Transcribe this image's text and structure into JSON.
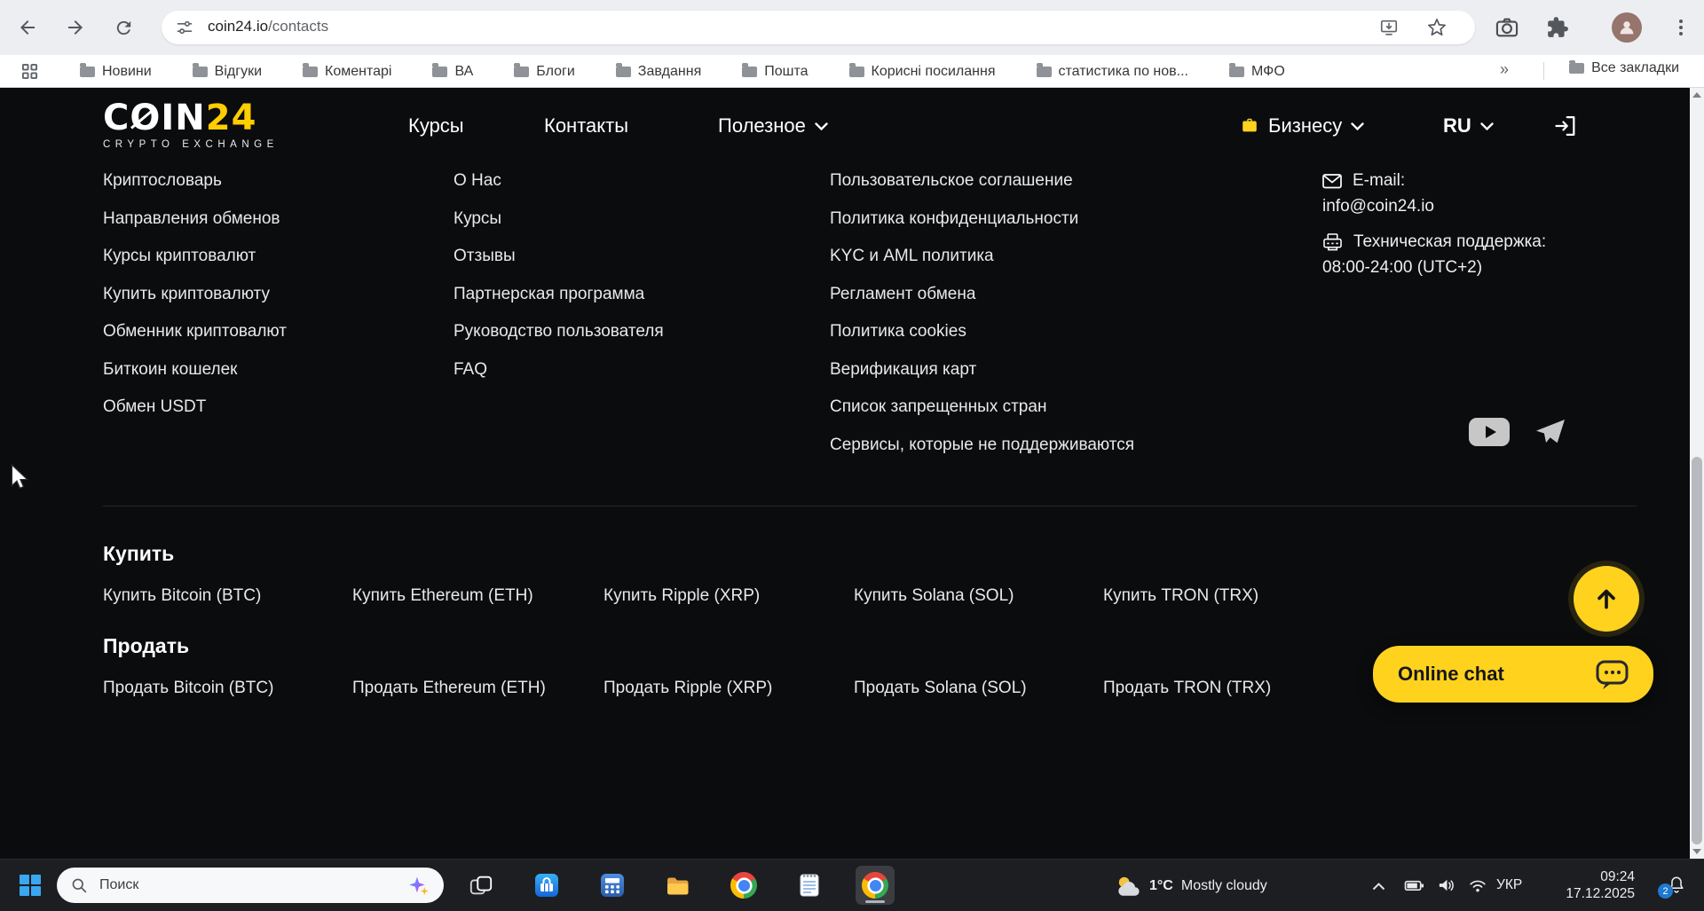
{
  "browser": {
    "url_domain": "coin24.io",
    "url_path": "/contacts"
  },
  "bookmarks_bar": {
    "items": [
      "Новини",
      "Відгуки",
      "Коментарі",
      "ВА",
      "Блоги",
      "Завдання",
      "Пошта",
      "Корисні посилання",
      "статистика по нов...",
      "МФО"
    ],
    "overflow": "»",
    "all_bookmarks": "Все закладки"
  },
  "site": {
    "logo": {
      "c": "C",
      "o": "O",
      "rest": "IN",
      "num": "24",
      "subtitle": "CRYPTO EXCHANGE"
    },
    "nav": [
      "Курсы",
      "Контакты",
      "Полезное"
    ],
    "business": "Бизнесу",
    "lang": "RU"
  },
  "footer": {
    "col1": [
      "Криптословарь",
      "Направления обменов",
      "Курсы криптовалют",
      "Купить криптовалюту",
      "Обменник криптовалют",
      "Биткоин кошелек",
      "Обмен USDT"
    ],
    "col2": [
      "О Нас",
      "Курсы",
      "Отзывы",
      "Партнерская программа",
      "Руководство пользователя",
      "FAQ"
    ],
    "col3": [
      "Пользовательское соглашение",
      "Политика конфиденциальности",
      "KYC и AML политика",
      "Регламент обмена",
      "Политика cookies",
      "Верификация карт",
      "Список запрещенных стран",
      "Сервисы, которые не поддерживаются"
    ],
    "contact": {
      "email_label": "E-mail:",
      "email": "info@coin24.io",
      "support_label": "Техническая поддержка:",
      "support_hours": "08:00-24:00 (UTC+2)"
    }
  },
  "buy": {
    "heading": "Купить",
    "links": [
      "Купить Bitcoin (BTC)",
      "Купить Ethereum (ETH)",
      "Купить Ripple (XRP)",
      "Купить Solana (SOL)",
      "Купить TRON (TRX)"
    ]
  },
  "sell": {
    "heading": "Продать",
    "links": [
      "Продать Bitcoin (BTC)",
      "Продать Ethereum (ETH)",
      "Продать Ripple (XRP)",
      "Продать Solana (SOL)",
      "Продать TRON (TRX)"
    ]
  },
  "chat": {
    "label": "Online chat"
  },
  "taskbar": {
    "search_placeholder": "Поиск",
    "weather_temp": "1°C",
    "weather_desc": "Mostly cloudy",
    "lang": "УКР",
    "time": "09:24",
    "date": "17.12.2025",
    "notification_count": "2"
  },
  "colors": {
    "brand_yellow": "#ffd21e",
    "page_bg": "#0b0c0e"
  }
}
